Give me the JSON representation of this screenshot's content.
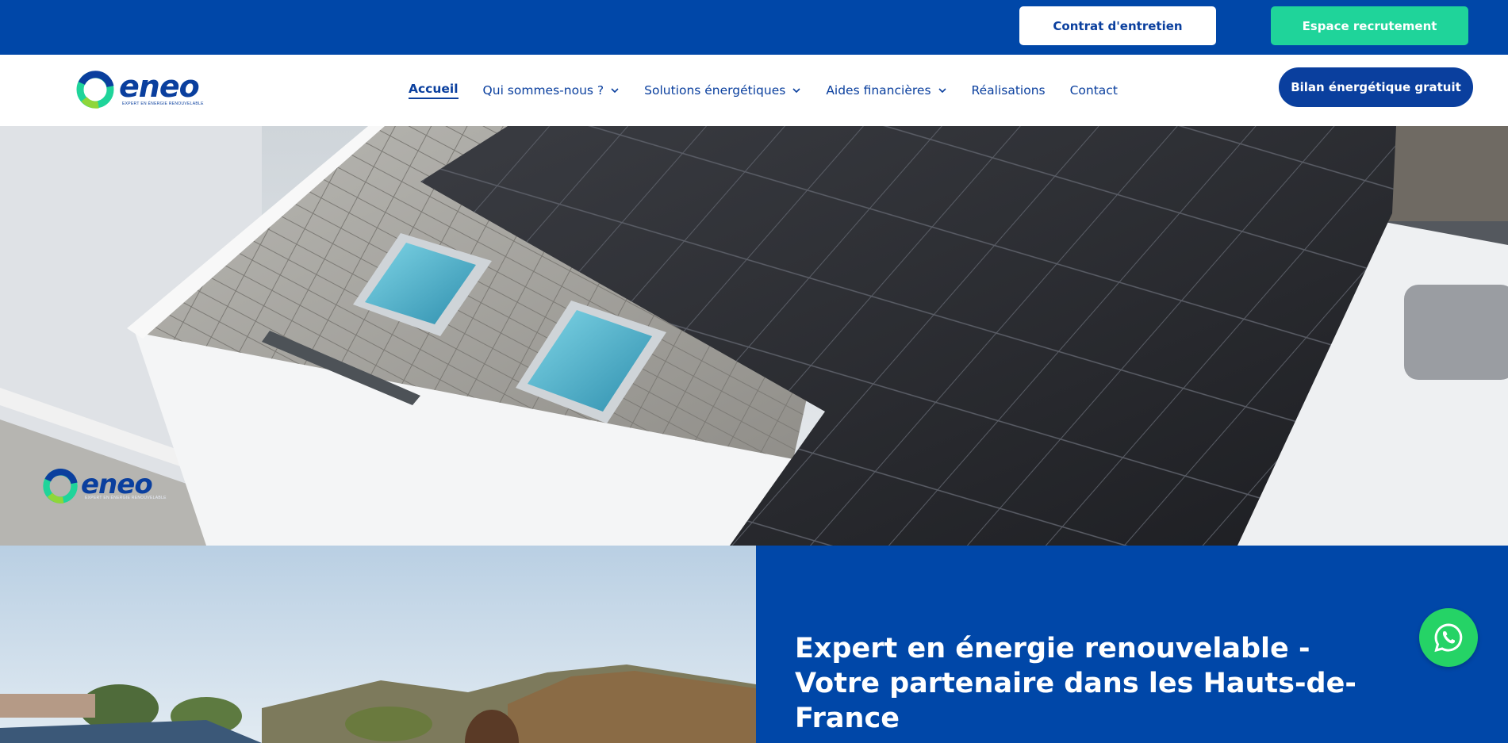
{
  "topbar": {
    "contrat_label": "Contrat d'entretien",
    "recrutement_label": "Espace recrutement"
  },
  "header": {
    "logo_text": "eneo",
    "logo_tagline": "EXPERT EN ÉNERGIE RENOUVELABLE",
    "nav": [
      {
        "label": "Accueil",
        "active": true,
        "dropdown": false
      },
      {
        "label": "Qui sommes-nous ?",
        "active": false,
        "dropdown": true
      },
      {
        "label": "Solutions énergétiques",
        "active": false,
        "dropdown": true
      },
      {
        "label": "Aides financières",
        "active": false,
        "dropdown": true
      },
      {
        "label": "Réalisations",
        "active": false,
        "dropdown": false
      },
      {
        "label": "Contact",
        "active": false,
        "dropdown": false
      }
    ],
    "cta_label": "Bilan énergétique gratuit"
  },
  "hero": {
    "logo_text": "eneo",
    "logo_tagline": "EXPERT EN ÉNERGIE RENOUVELABLE"
  },
  "intro": {
    "headline": "Expert en énergie renouvelable - Votre partenaire dans les Hauts-de-France"
  },
  "icons": {
    "whatsapp": "whatsapp-icon",
    "chevron": "chevron-down-icon"
  },
  "colors": {
    "primary_blue": "#0047a8",
    "brand_navy": "#0a3f9e",
    "accent_green": "#1fd49a",
    "whatsapp_green": "#25d366"
  }
}
